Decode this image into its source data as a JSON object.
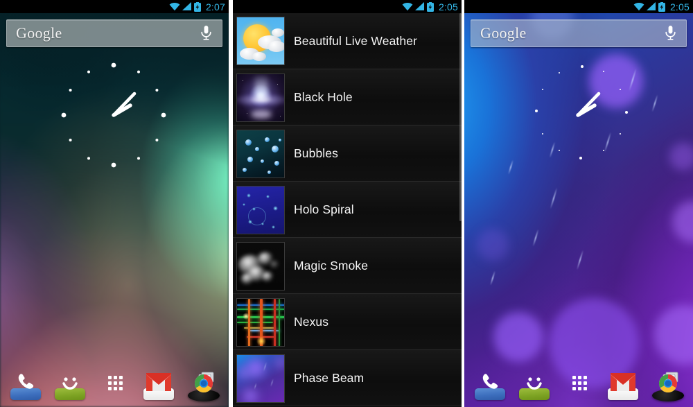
{
  "panels": [
    {
      "id": "home-left",
      "type": "home-screen",
      "status_bar": {
        "time": "2:07",
        "icons": [
          "wifi-icon",
          "signal-icon",
          "battery-charging-icon"
        ],
        "accent_color": "#33b5e5"
      },
      "search_widget": {
        "label": "Google",
        "mic_icon": "microphone-icon"
      },
      "clock_widget": {
        "name": "analog-clock",
        "time": "2:07"
      },
      "wallpaper": {
        "name": "Default ICS Wallpaper",
        "colors": [
          "#08262b",
          "#78ffcd",
          "#f5f0aa",
          "#f6aab9",
          "#965fa0"
        ]
      }
    },
    {
      "id": "live-wallpaper-picker",
      "type": "list-picker",
      "status_bar": {
        "time": "2:05",
        "icons": [
          "wifi-icon",
          "signal-icon",
          "battery-charging-icon"
        ],
        "accent_color": "#33b5e5"
      },
      "items": [
        {
          "label": "Beautiful Live Weather",
          "thumb": "weather-thumbnail"
        },
        {
          "label": "Black Hole",
          "thumb": "black-hole-thumbnail"
        },
        {
          "label": "Bubbles",
          "thumb": "bubbles-thumbnail"
        },
        {
          "label": "Holo Spiral",
          "thumb": "holo-spiral-thumbnail"
        },
        {
          "label": "Magic Smoke",
          "thumb": "magic-smoke-thumbnail"
        },
        {
          "label": "Nexus",
          "thumb": "nexus-thumbnail"
        },
        {
          "label": "Phase Beam",
          "thumb": "phase-beam-thumbnail"
        }
      ]
    },
    {
      "id": "home-right",
      "type": "home-screen",
      "status_bar": {
        "time": "2:05",
        "icons": [
          "wifi-icon",
          "signal-icon",
          "battery-charging-icon"
        ],
        "accent_color": "#33b5e5"
      },
      "search_widget": {
        "label": "Google",
        "mic_icon": "microphone-icon"
      },
      "clock_widget": {
        "name": "analog-clock",
        "time": "2:05"
      },
      "wallpaper": {
        "name": "Phase Beam",
        "colors": [
          "#1b8de8",
          "#3550c0",
          "#6a2ab4",
          "#8b2fd0"
        ]
      }
    }
  ],
  "dock": {
    "items": [
      {
        "name": "phone",
        "icon": "phone-icon",
        "color": "#3d6fbe"
      },
      {
        "name": "messaging",
        "icon": "message-smiley-icon",
        "color": "#7ea424"
      },
      {
        "name": "all-apps",
        "icon": "apps-grid-icon",
        "color": "#9a39c2"
      },
      {
        "name": "gmail",
        "icon": "gmail-envelope-icon",
        "color": "#d93025"
      },
      {
        "name": "browser",
        "icon": "chrome-browser-icon",
        "color": "#4285f4"
      }
    ]
  }
}
